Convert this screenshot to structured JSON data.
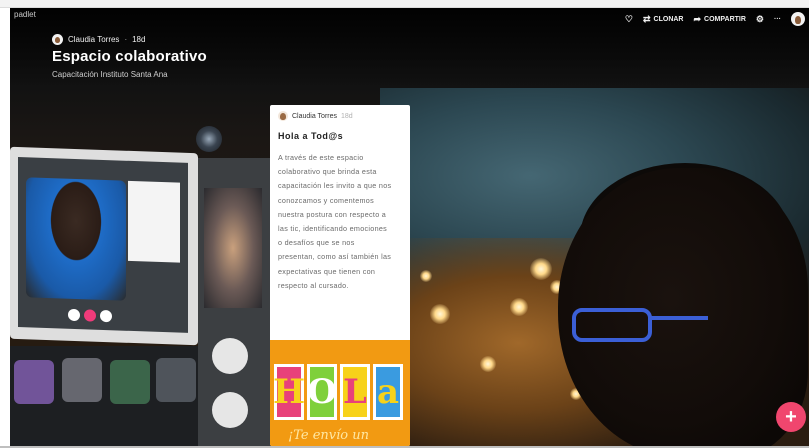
{
  "app": {
    "brand": "padlet"
  },
  "header": {
    "author": "Claudia Torres",
    "age": "18d",
    "title": "Espacio colaborativo",
    "subtitle": "Capacitación Instituto Santa Ana"
  },
  "toolbar": {
    "heart_icon": "heart-icon",
    "clone_label": "CLONAR",
    "share_label": "COMPARTIR",
    "more_label": "···"
  },
  "post": {
    "author": "Claudia Torres",
    "age": "18d",
    "title": "Hola a Tod@s",
    "body_lines": [
      "A través de este espacio",
      "colaborativo que brinda esta",
      "capacitación les invito a que nos",
      "conozcamos y comentemos",
      "nuestra postura con respecto a",
      "las tic, identificando emociones",
      "o  desafíos que se nos",
      "presentan,   como así también las",
      "expectativas  que tienen con",
      "respecto al cursado."
    ],
    "image": {
      "letters": [
        "H",
        "O",
        "L",
        "a"
      ],
      "letter_colors": [
        "#e8417a",
        "#7fd03b",
        "#f7d21a",
        "#3a9be0"
      ],
      "caption": "¡Te envío un"
    }
  },
  "fab": {
    "label": "+"
  },
  "colors": {
    "fab": "#f0466e",
    "image_bg": "#f29a12"
  }
}
